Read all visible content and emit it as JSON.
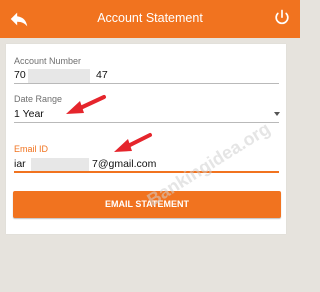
{
  "header": {
    "title": "Account Statement",
    "back_icon": "back-arrow-icon",
    "power_icon": "power-icon"
  },
  "form": {
    "account_number": {
      "label": "Account Number",
      "value_prefix": "70",
      "value_suffix": "47"
    },
    "date_range": {
      "label": "Date Range",
      "value": "1 Year"
    },
    "email": {
      "label": "Email ID",
      "value_prefix": "iar",
      "value_suffix": "7@gmail.com"
    },
    "submit_label": "EMAIL STATEMENT"
  },
  "watermark": {
    "text": "Bankingidea.org"
  },
  "colors": {
    "accent": "#f1731f",
    "annotation_arrow": "#e5252c",
    "background": "#e6e3dd"
  }
}
